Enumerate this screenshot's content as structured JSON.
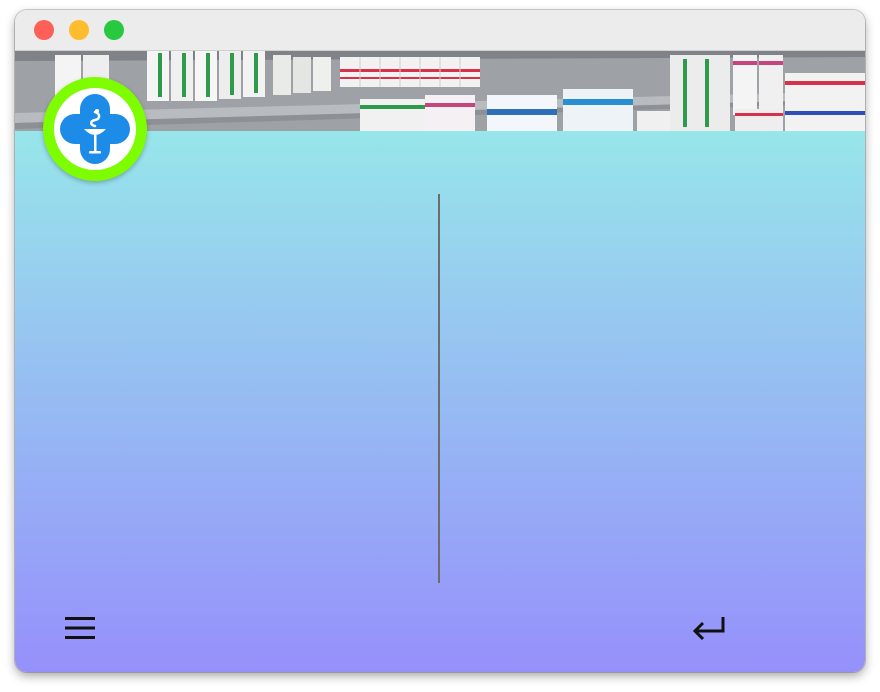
{
  "theme": {
    "gradient_top": "#97e6ea",
    "gradient_bottom": "#9690fb",
    "logo_ring": "#7efc00",
    "logo_cross": "#1d8ce8",
    "traffic_close": "#fe5f57",
    "traffic_minimize": "#febc2e",
    "traffic_maximize": "#28c840"
  },
  "window": {
    "controls": [
      "close",
      "minimize",
      "maximize"
    ]
  },
  "header": {
    "banner_image": "pharmacy-shelves-photo",
    "logo": "pharmacy-cross-logo"
  },
  "footer": {
    "menu_icon": "hamburger-menu-icon",
    "back_icon": "return-arrow-icon"
  }
}
